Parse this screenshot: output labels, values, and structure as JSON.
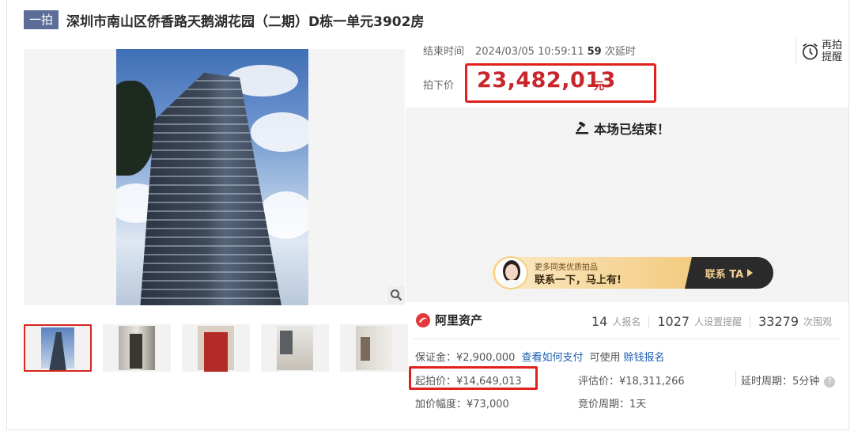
{
  "title": {
    "badge": "一拍",
    "text": "深圳市南山区侨香路天鹅湖花园（二期）D栋一单元3902房"
  },
  "auction": {
    "end_label": "结束时间",
    "end_time": "2024/03/05 10:59:11",
    "delay_count": "59",
    "delay_suffix": "次延时",
    "price_label": "拍下价",
    "price": "23,482,013",
    "price_unit": "元",
    "remind": "再拍提醒",
    "status": "本场已结束！"
  },
  "banner": {
    "sub": "更多同类优质拍品",
    "main": "联系一下，马上有!",
    "button": "联系 TA"
  },
  "brand": {
    "name": "阿里资产"
  },
  "stats": [
    {
      "value": "14",
      "unit": "人报名"
    },
    {
      "value": "1027",
      "unit": "人设置提醒"
    },
    {
      "value": "33279",
      "unit": "次围观"
    }
  ],
  "details": {
    "deposit": "保证金：¥2,900,000",
    "how_pay": "查看如何支付",
    "can_use": "可使用",
    "signup": "赊钱报名",
    "start_price": "起拍价：¥14,649,013",
    "assess_price": "评估价：¥18,311,266",
    "delay_period": "延时周期：5分钟",
    "increment": "加价幅度：¥73,000",
    "bid_period": "竞价周期：1天"
  },
  "colors": {
    "accent": "#c8262b",
    "highlight_border": "#e0211d",
    "link": "#1e5fb0",
    "badge": "#5c6e98"
  },
  "icons": [
    "zoom-icon",
    "alarm-clock-icon",
    "gavel-icon",
    "alibaba-logo-icon",
    "help-icon",
    "play-arrow-icon"
  ]
}
